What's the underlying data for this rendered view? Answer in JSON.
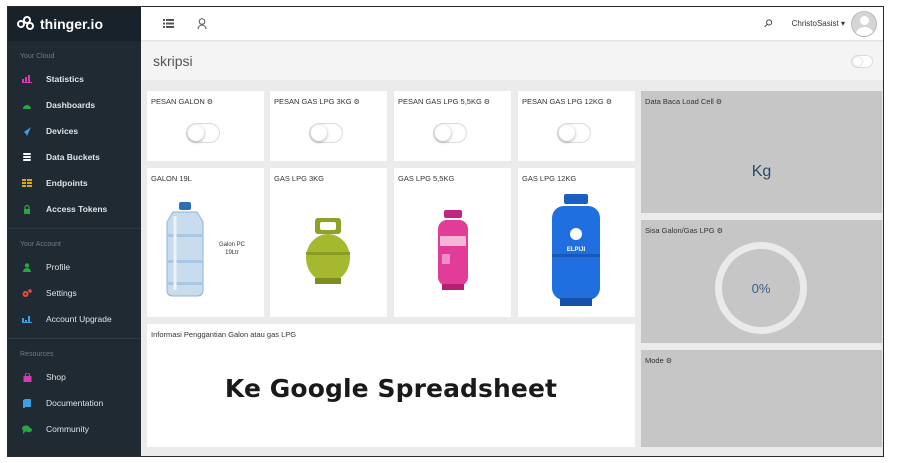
{
  "brand": {
    "name": "thinger.io"
  },
  "sidebar": {
    "sections": [
      {
        "title": "Your Cloud",
        "items": [
          {
            "label": "Statistics",
            "icon": "bar-chart-icon",
            "color": "#d63bb7"
          },
          {
            "label": "Dashboards",
            "icon": "dashboard-icon",
            "color": "#28a745"
          },
          {
            "label": "Devices",
            "icon": "rocket-icon",
            "color": "#3aa0e6"
          },
          {
            "label": "Data Buckets",
            "icon": "database-icon",
            "color": "#ffffff"
          },
          {
            "label": "Endpoints",
            "icon": "endpoints-icon",
            "color": "#e0a800"
          },
          {
            "label": "Access Tokens",
            "icon": "lock-icon",
            "color": "#28a745"
          }
        ]
      },
      {
        "title": "Your Account",
        "items": [
          {
            "label": "Profile",
            "icon": "user-icon",
            "color": "#28a745"
          },
          {
            "label": "Settings",
            "icon": "gears-icon",
            "color": "#e74c3c"
          },
          {
            "label": "Account Upgrade",
            "icon": "chart-icon",
            "color": "#3aa0e6"
          }
        ]
      },
      {
        "title": "Resources",
        "items": [
          {
            "label": "Shop",
            "icon": "shop-icon",
            "color": "#d63bb7"
          },
          {
            "label": "Documentation",
            "icon": "book-icon",
            "color": "#3aa0e6"
          },
          {
            "label": "Community",
            "icon": "comments-icon",
            "color": "#28a745"
          }
        ]
      }
    ]
  },
  "topbar": {
    "user": "ChristoSasist ▾"
  },
  "page": {
    "title": "skripsi"
  },
  "widgets": {
    "pesan_galon": {
      "title": "PESAN GALON"
    },
    "pesan_3kg": {
      "title": "PESAN GAS LPG 3KG"
    },
    "pesan_55kg": {
      "title": "PESAN GAS LPG 5,5KG"
    },
    "pesan_12kg": {
      "title": "PESAN GAS LPG 12KG"
    },
    "galon": {
      "title": "GALON 19L",
      "image_label_1": "Galon PC",
      "image_label_2": "19Ltr"
    },
    "gas3": {
      "title": "GAS LPG 3KG"
    },
    "gas55": {
      "title": "GAS LPG 5,5KG"
    },
    "gas12": {
      "title": "GAS LPG 12KG",
      "brand": "ELPIJI"
    },
    "load_cell": {
      "title": "Data Baca Load Cell",
      "unit": "Kg"
    },
    "sisa": {
      "title": "Sisa Galon/Gas LPG",
      "value": "0%"
    },
    "mode": {
      "title": "Mode"
    },
    "info": {
      "title": "Informasi Penggantian Galon atau gas LPG",
      "text": "Ke Google Spreadsheet"
    }
  }
}
